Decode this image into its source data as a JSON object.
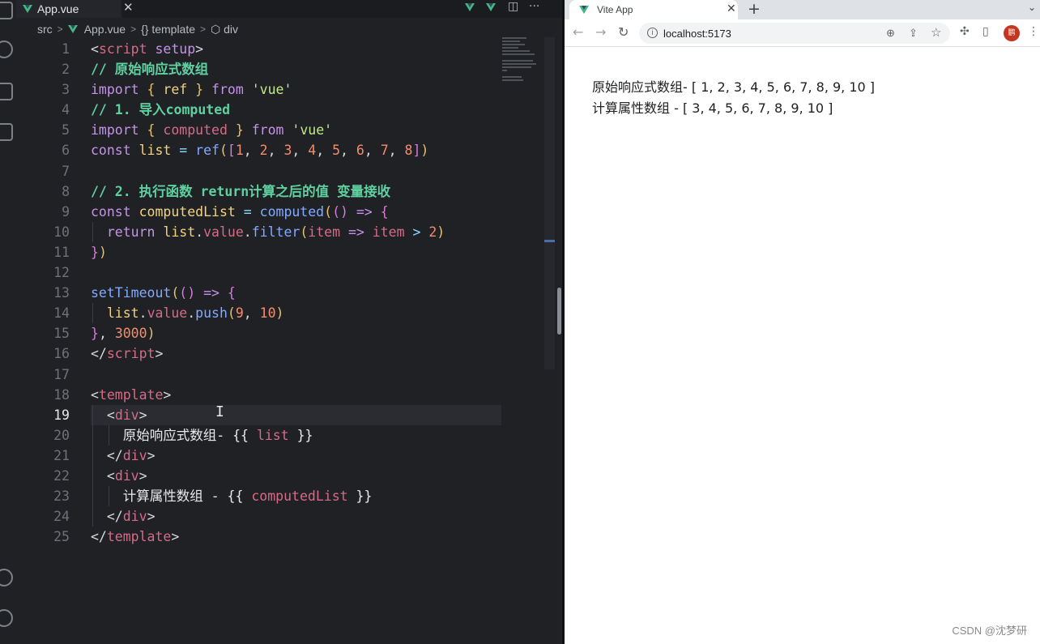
{
  "editor": {
    "tab": {
      "label": "App.vue",
      "close": "✕"
    },
    "tab_actions": {
      "split": "◫",
      "more": "···"
    },
    "breadcrumb": {
      "src": "src",
      "file": "App.vue",
      "template": "{} template",
      "div": "⬡ div"
    },
    "active_line": 19,
    "lines": [
      {
        "n": "1",
        "html": "<span class='k-white'>&lt;</span><span class='k-name'>script</span> <span class='k-attr'>setup</span><span class='k-white'>&gt;</span>"
      },
      {
        "n": "2",
        "html": "<span class='k-cm'>// 原始响应式数组</span>"
      },
      {
        "n": "3",
        "html": "<span class='k-kw'>import</span> <span class='k-br'>{</span> <span class='k-var'>ref</span> <span class='k-br'>}</span> <span class='k-kw'>from</span> <span class='k-str'>'vue'</span>"
      },
      {
        "n": "4",
        "html": "<span class='k-cm'>// 1. 导入computed</span>"
      },
      {
        "n": "5",
        "html": "<span class='k-kw'>import</span> <span class='k-br'>{</span> <span class='k-name'>computed</span> <span class='k-br'>}</span> <span class='k-kw'>from</span> <span class='k-str'>'vue'</span>"
      },
      {
        "n": "6",
        "html": "<span class='k-kw'>const</span> <span class='k-var'>list</span> <span class='k-op'>=</span> <span class='k-fn'>ref</span><span class='k-br'>(</span><span class='k-br2'>[</span><span class='k-num'>1</span>, <span class='k-num'>2</span>, <span class='k-num'>3</span>, <span class='k-num'>4</span>, <span class='k-num'>5</span>, <span class='k-num'>6</span>, <span class='k-num'>7</span>, <span class='k-num'>8</span><span class='k-br2'>]</span><span class='k-br'>)</span>"
      },
      {
        "n": "7",
        "html": ""
      },
      {
        "n": "8",
        "html": "<span class='k-cm'>// 2. 执行函数 return计算之后的值 变量接收</span>"
      },
      {
        "n": "9",
        "html": "<span class='k-kw'>const</span> <span class='k-var'>computedList</span> <span class='k-op'>=</span> <span class='k-fn'>computed</span><span class='k-br'>(</span><span class='k-br2'>()</span> <span class='k-kw'>=&gt;</span> <span class='k-br2'>{</span>"
      },
      {
        "n": "10",
        "html": "  <span class='k-kw'>return</span> <span class='k-var'>list</span>.<span class='k-name'>value</span>.<span class='k-fn'>filter</span><span class='k-br'>(</span><span class='k-name'>item</span> <span class='k-kw'>=&gt;</span> <span class='k-name'>item</span> <span class='k-op'>&gt;</span> <span class='k-num'>2</span><span class='k-br'>)</span>"
      },
      {
        "n": "11",
        "html": "<span class='k-br2'>}</span><span class='k-br'>)</span>"
      },
      {
        "n": "12",
        "html": ""
      },
      {
        "n": "13",
        "html": "<span class='k-fn'>setTimeout</span><span class='k-br'>(</span><span class='k-br2'>()</span> <span class='k-kw'>=&gt;</span> <span class='k-br2'>{</span>"
      },
      {
        "n": "14",
        "html": "  <span class='k-var'>list</span>.<span class='k-name'>value</span>.<span class='k-fn'>push</span><span class='k-br'>(</span><span class='k-num'>9</span>, <span class='k-num'>10</span><span class='k-br'>)</span>"
      },
      {
        "n": "15",
        "html": "<span class='k-br2'>}</span>, <span class='k-num'>3000</span><span class='k-br'>)</span>"
      },
      {
        "n": "16",
        "html": "<span class='k-white'>&lt;/</span><span class='k-name'>script</span><span class='k-white'>&gt;</span>"
      },
      {
        "n": "17",
        "html": ""
      },
      {
        "n": "18",
        "html": "<span class='k-white'>&lt;</span><span class='k-name'>template</span><span class='k-white'>&gt;</span>"
      },
      {
        "n": "19",
        "html": "  <span class='k-white'>&lt;</span><span class='k-name'>div</span><span class='k-white'>&gt;</span>"
      },
      {
        "n": "20",
        "html": "    <span class='k-txt'>原始响应式数组- {{</span> <span class='k-name'>list</span> <span class='k-txt'>}}</span>"
      },
      {
        "n": "21",
        "html": "  <span class='k-white'>&lt;/</span><span class='k-name'>div</span><span class='k-white'>&gt;</span>"
      },
      {
        "n": "22",
        "html": "  <span class='k-white'>&lt;</span><span class='k-name'>div</span><span class='k-white'>&gt;</span>"
      },
      {
        "n": "23",
        "html": "    <span class='k-txt'>计算属性数组 - {{</span> <span class='k-name'>computedList</span> <span class='k-txt'>}}</span>"
      },
      {
        "n": "24",
        "html": "  <span class='k-white'>&lt;/</span><span class='k-name'>div</span><span class='k-white'>&gt;</span>"
      },
      {
        "n": "25",
        "html": "<span class='k-white'>&lt;/</span><span class='k-name'>template</span><span class='k-white'>&gt;</span>"
      }
    ]
  },
  "browser": {
    "tab_title": "Vite App",
    "tab_close": "✕",
    "new_tab": "+",
    "url": "localhost:5173",
    "profile_initial": "鹏",
    "content": [
      "原始响应式数组- [ 1, 2, 3, 4, 5, 6, 7, 8, 9, 10 ]",
      "计算属性数组 - [ 3, 4, 5, 6, 7, 8, 9, 10 ]"
    ]
  },
  "watermark": "CSDN @沈梦研",
  "icons": {
    "back": "←",
    "forward": "→",
    "reload": "↻",
    "zoom": "⊕",
    "share": "⇪",
    "star": "☆",
    "extensions": "✣",
    "sidepanel": "▯",
    "menu": "⋮",
    "dropdown": "⌄",
    "info": "i",
    "text_cursor": "I"
  },
  "colors": {
    "vue_green": "#42b883",
    "editor_bg": "#1f2125",
    "accent_blue": "#4a6fa8"
  }
}
